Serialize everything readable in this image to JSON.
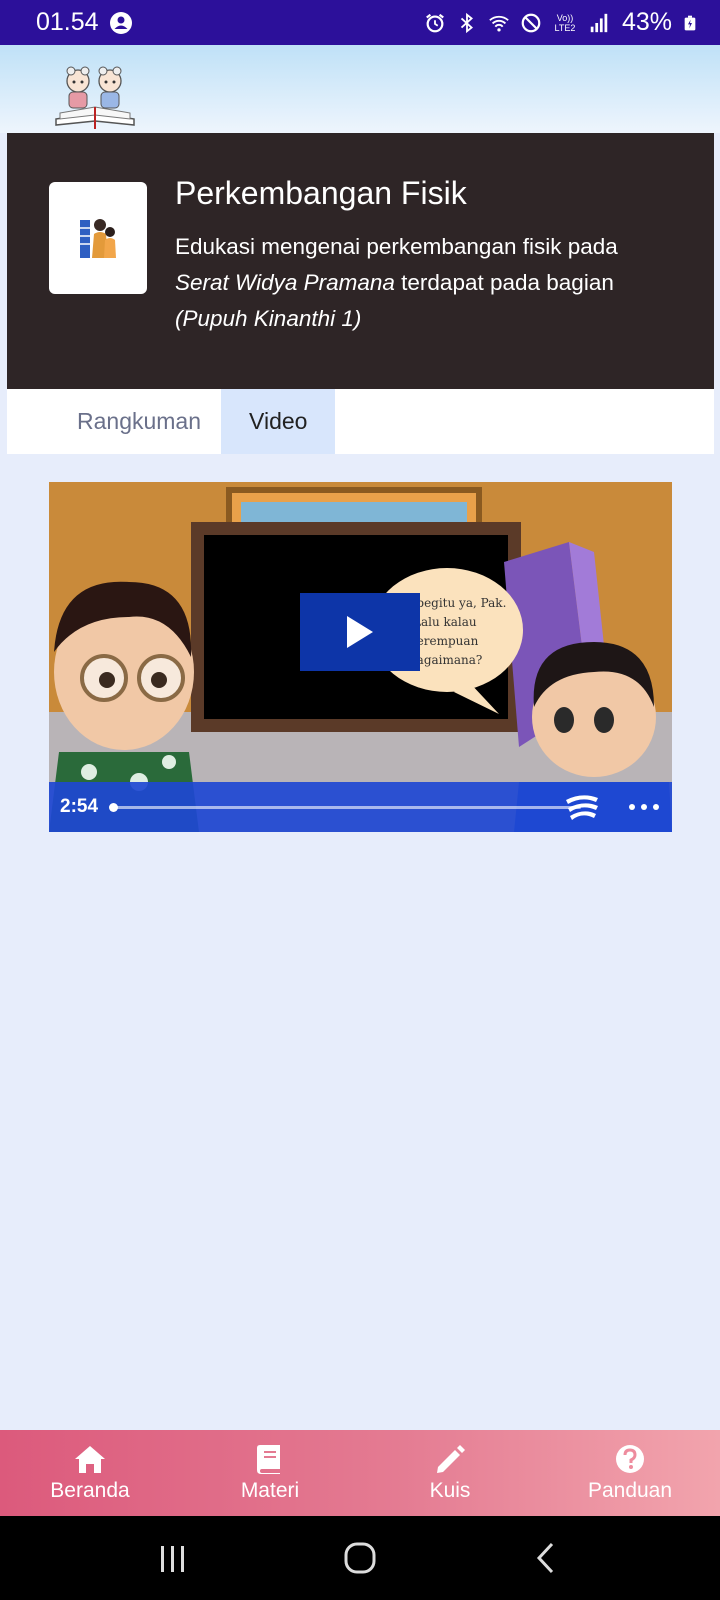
{
  "status_bar": {
    "time": "01.54",
    "battery": "43%",
    "network_label": "Vo)) LTE2"
  },
  "header": {
    "logo": "reading-kids-logo"
  },
  "banner": {
    "title": "Perkembangan Fisik",
    "desc_prefix": "Edukasi mengenai perkembangan fisik pada ",
    "desc_em1": "Serat Widya Pramana",
    "desc_mid": " terdapat pada bagian ",
    "desc_em2": "(Pupuh Kinanthi 1)"
  },
  "tabs": [
    {
      "label": "Rangkuman",
      "active": false
    },
    {
      "label": "Video",
      "active": true
    }
  ],
  "video": {
    "timecode": "2:54",
    "speech_bubble": [
      "Oh begitu ya, Pak.",
      "Lalu kalau",
      "perempuan",
      "bagaimana?"
    ],
    "progress_fraction": 0
  },
  "bottom_nav": [
    {
      "label": "Beranda",
      "icon": "home-icon"
    },
    {
      "label": "Materi",
      "icon": "book-icon"
    },
    {
      "label": "Kuis",
      "icon": "pencil-icon"
    },
    {
      "label": "Panduan",
      "icon": "help-icon"
    }
  ],
  "colors": {
    "status_bar": "#2c109a",
    "banner": "#2e2526",
    "tab_active": "#d8e6fc",
    "page_bg": "#e7edfb",
    "video_controls": "#1e48d2",
    "nav_gradient_start": "#dc5a7c",
    "nav_gradient_end": "#f2a4ad"
  }
}
